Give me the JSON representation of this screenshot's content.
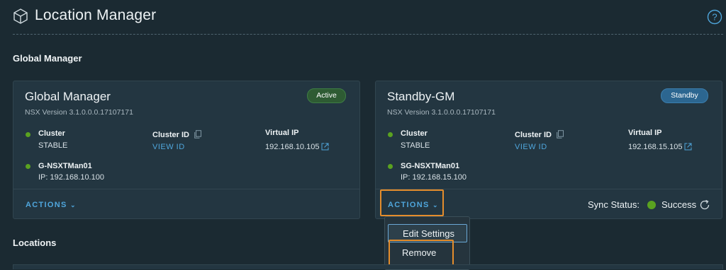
{
  "page": {
    "title": "Location Manager",
    "help_icon": "help-circle-icon"
  },
  "sections": {
    "global_manager_title": "Global Manager",
    "locations_title": "Locations"
  },
  "cards": [
    {
      "title": "Global Manager",
      "badge": "Active",
      "nsx_version": "NSX Version  3.1.0.0.0.17107171",
      "cluster_label": "Cluster",
      "cluster_value": "STABLE",
      "cluster_id_label": "Cluster ID",
      "cluster_id_link": "VIEW ID",
      "virtual_ip_label": "Virtual IP",
      "virtual_ip_value": "192.168.10.105",
      "node_name": "G-NSXTMan01",
      "node_ip": "IP: 192.168.10.100",
      "actions_label": "ACTIONS"
    },
    {
      "title": "Standby-GM",
      "badge": "Standby",
      "nsx_version": "NSX Version  3.1.0.0.0.17107171",
      "cluster_label": "Cluster",
      "cluster_value": "STABLE",
      "cluster_id_label": "Cluster ID",
      "cluster_id_link": "VIEW ID",
      "virtual_ip_label": "Virtual IP",
      "virtual_ip_value": "192.168.15.105",
      "node_name": "SG-NSXTMan01",
      "node_ip": "IP: 192.168.15.100",
      "actions_label": "ACTIONS",
      "sync_label": "Sync Status:",
      "sync_status": "Success"
    }
  ],
  "actions_menu": {
    "items": [
      "Edit Settings",
      "Remove"
    ]
  },
  "colors": {
    "background": "#1b2a32",
    "card": "#233641",
    "accent_link": "#4fa6dc",
    "status_green": "#5aa220",
    "active_badge": "#2e5b33",
    "standby_badge": "#2c6690",
    "highlight": "#e48d2c"
  }
}
